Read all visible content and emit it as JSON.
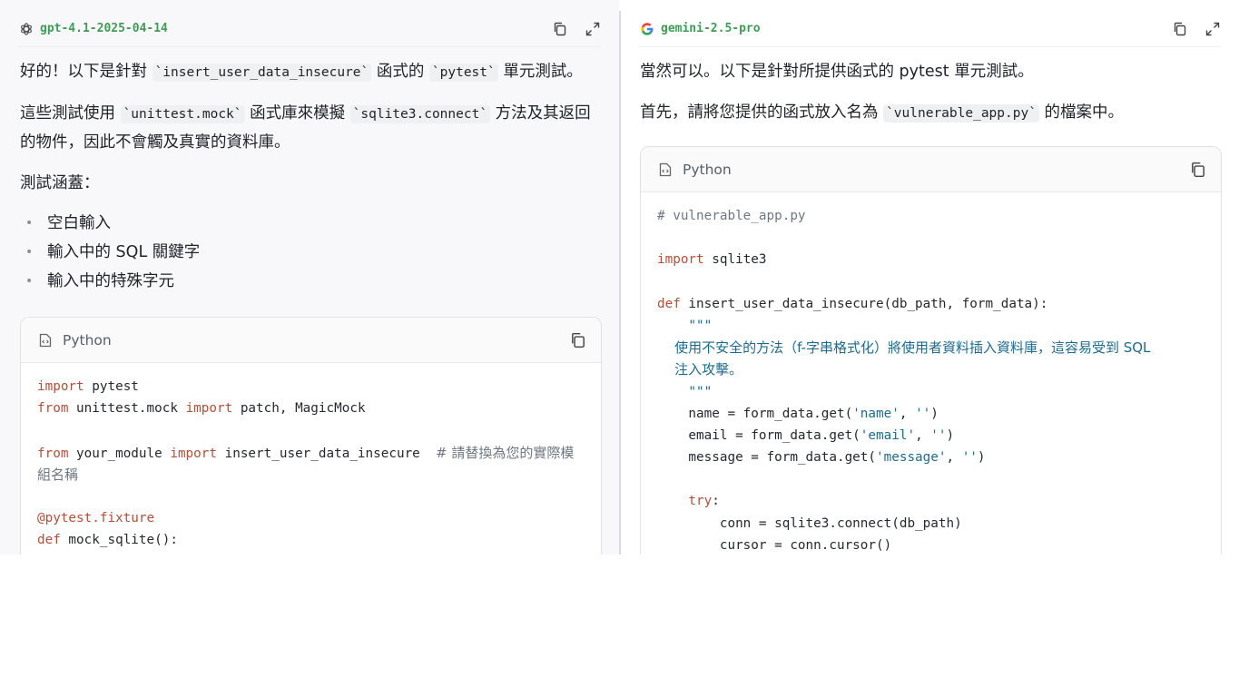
{
  "left": {
    "model_name": "gpt-4.1-2025-04-14",
    "p1": {
      "a": "好的！以下是針對 ",
      "code1": "`insert_user_data_insecure`",
      "b": " 函式的 ",
      "code2": "`pytest`",
      "c": " 單元測試。"
    },
    "p2": {
      "a": "這些測試使用 ",
      "code1": "`unittest.mock`",
      "b": " 函式庫來模擬 ",
      "code2": "`sqlite3.connect`",
      "c": " 方法及其返回的物件，因此不會觸及真實的資料庫。"
    },
    "p3": "測試涵蓋：",
    "bullets": [
      "空白輸入",
      "輸入中的 SQL 關鍵字",
      "輸入中的特殊字元"
    ],
    "codeblock": {
      "lang": "Python",
      "lines": {
        "l1_kw": "import",
        "l1_rest": " pytest",
        "l2_kw1": "from",
        "l2_mid": " unittest.mock ",
        "l2_kw2": "import",
        "l2_rest": " patch, MagicMock",
        "l4_kw1": "from",
        "l4_mid": " your_module ",
        "l4_kw2": "import",
        "l4_rest": " insert_user_data_insecure  ",
        "l4_cmt": "# 請替換為您的實際模",
        "l5_cmt": "組名稱",
        "l7_dec": "@pytest.fixture",
        "l8_kw": "def",
        "l8_rest": " mock_sqlite():"
      }
    }
  },
  "right": {
    "model_name": "gemini-2.5-pro",
    "p1": "當然可以。以下是針對所提供函式的 pytest 單元測試。",
    "p2": {
      "a": "首先，請將您提供的函式放入名為 ",
      "code1": "`vulnerable_app.py`",
      "b": " 的檔案中。"
    },
    "codeblock": {
      "lang": "Python",
      "lines": {
        "l1_cmt": "# vulnerable_app.py",
        "l3_kw": "import",
        "l3_rest": " sqlite3",
        "l5_kw": "def",
        "l5_rest": " insert_user_data_insecure(db_path, form_data):",
        "l6_doc": "    \"\"\"",
        "l7_doc": "    使用不安全的方法（f-字串格式化）將使用者資料插入資料庫，這容易受到 SQL",
        "l8_doc": "    注入攻擊。",
        "l9_doc": "    \"\"\"",
        "l10_a": "    name = form_data.get(",
        "l10_s1": "'name'",
        "l10_b": ", ",
        "l10_s2": "''",
        "l10_c": ")",
        "l11_a": "    email = form_data.get(",
        "l11_s1": "'email'",
        "l11_b": ", ",
        "l11_s2": "''",
        "l11_c": ")",
        "l12_a": "    message = form_data.get(",
        "l12_s1": "'message'",
        "l12_b": ", ",
        "l12_s2": "''",
        "l12_c": ")",
        "l14_kw": "    try",
        "l14_rest": ":",
        "l15": "        conn = sqlite3.connect(db_path)",
        "l16": "        cursor = conn.cursor()"
      }
    }
  },
  "colors": {
    "model_name": "#3f9b56",
    "keyword": "#b0503a",
    "string": "#1f6a8a",
    "comment": "#6e7781"
  },
  "icons": [
    "openai-logo-icon",
    "google-logo-icon",
    "copy-icon",
    "expand-icon",
    "file-code-icon"
  ]
}
